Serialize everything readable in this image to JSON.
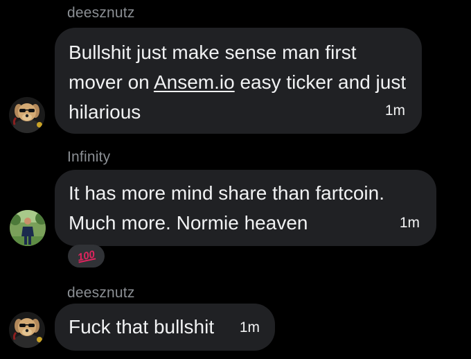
{
  "messages": [
    {
      "sender": "deesznutz",
      "text_before": "Bullshit just make sense man first mover on ",
      "link": "Ansem.io",
      "text_after": " easy ticker and just hilarious",
      "time": "1m"
    },
    {
      "sender": "Infinity",
      "text": "It has more mind share than fartcoin. Much more. Normie heaven",
      "time": "1m",
      "reaction": "100"
    },
    {
      "sender": "deesznutz",
      "text": "Fuck that bullshit",
      "time": "1m"
    }
  ],
  "colors": {
    "background": "#000000",
    "bubble": "#202124",
    "sender_name": "#8b8f94",
    "text": "#f1f2f3",
    "reaction_glyph": "#e0245e"
  }
}
